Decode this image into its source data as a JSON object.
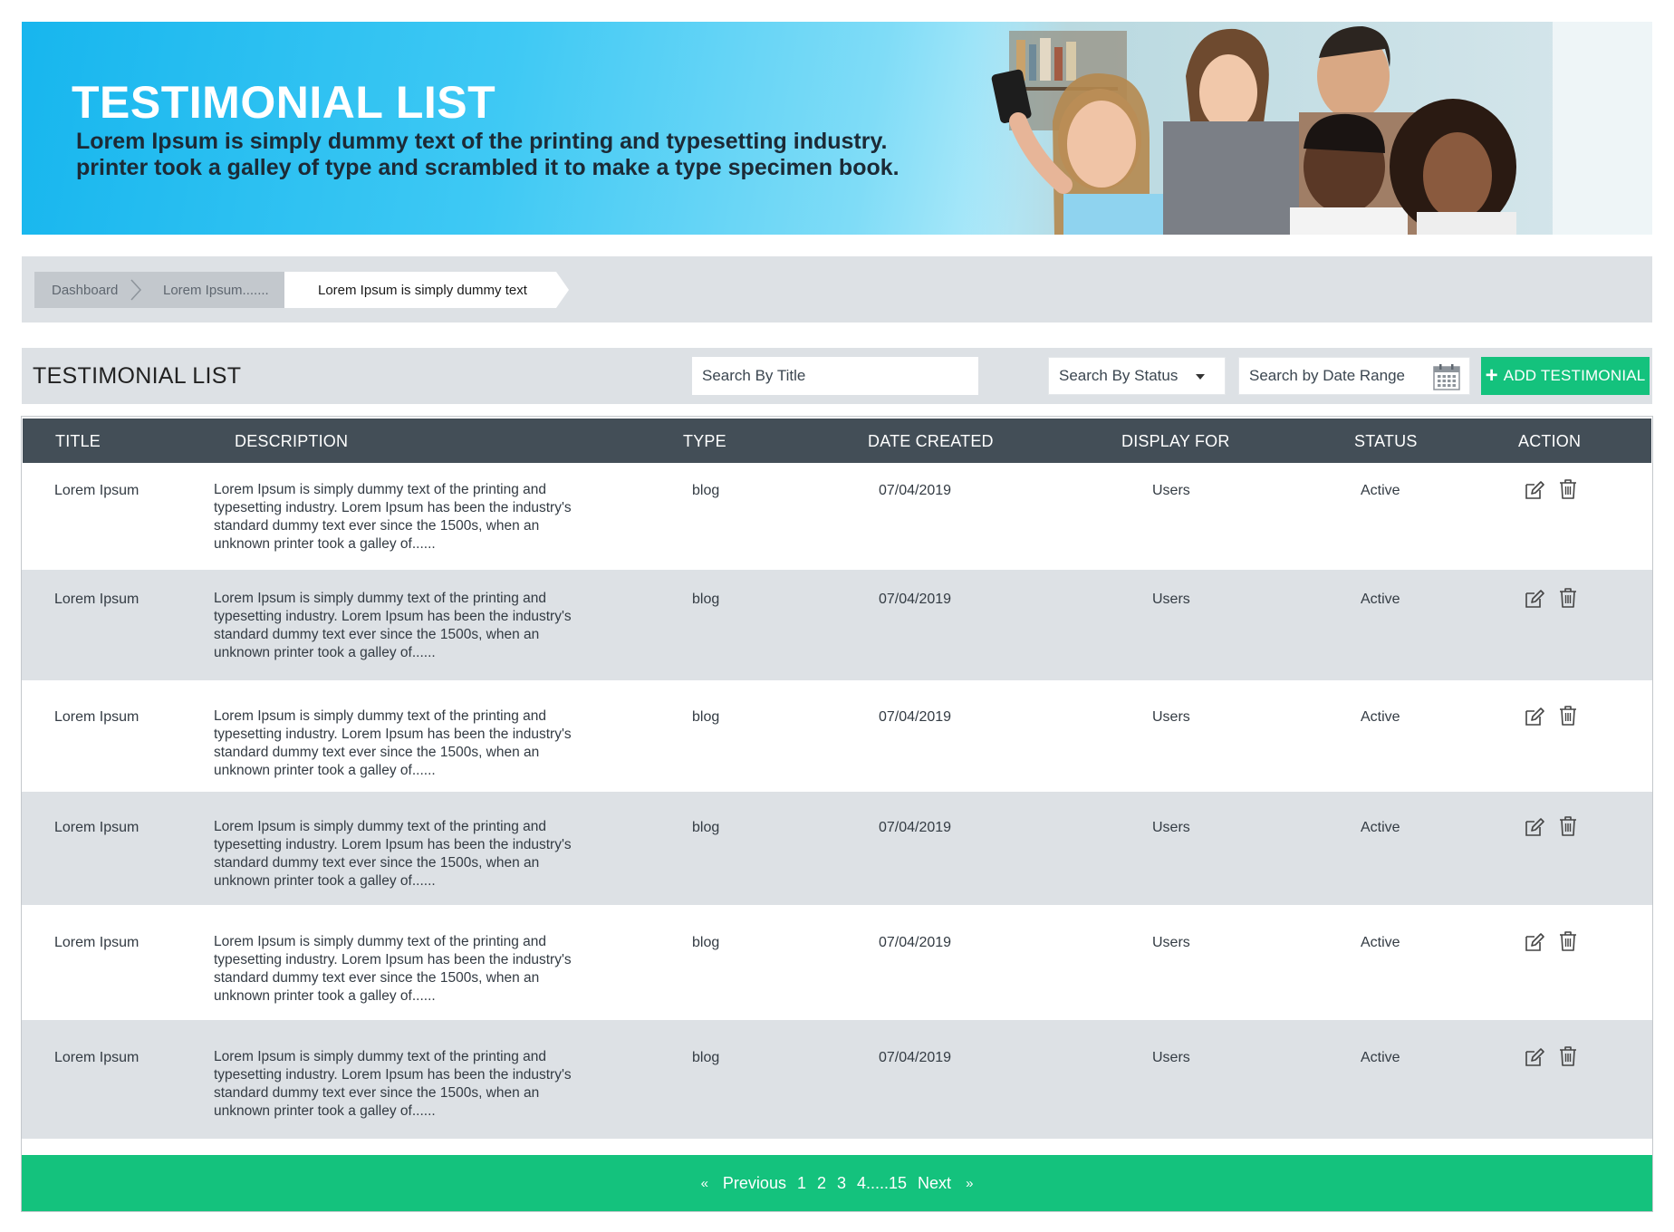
{
  "hero": {
    "title": "TESTIMONIAL LIST",
    "subtitle": "Lorem Ipsum is simply dummy text of the printing and typesetting industry. printer took a galley of type and scrambled it to make a type specimen book."
  },
  "breadcrumb": {
    "items": [
      "Dashboard",
      "Lorem Ipsum.......",
      "Lorem Ipsum is simply dummy text"
    ]
  },
  "toolbar": {
    "title": "TESTIMONIAL LIST",
    "search_title_placeholder": "Search By Title",
    "search_status_label": "Search By Status",
    "search_date_label": "Search by Date Range",
    "add_button_label": "ADD TESTIMONIAL"
  },
  "table": {
    "columns": [
      "TITLE",
      "DESCRIPTION",
      "TYPE",
      "DATE CREATED",
      "DISPLAY FOR",
      "STATUS",
      "ACTION"
    ],
    "rows": [
      {
        "title": "Lorem Ipsum",
        "description": "Lorem Ipsum is simply dummy text of the printing and typesetting industry. Lorem Ipsum has been the industry's standard dummy text ever since the 1500s, when an unknown printer took a galley of......",
        "type": "blog",
        "date": "07/04/2019",
        "display_for": "Users",
        "status": "Active"
      },
      {
        "title": "Lorem Ipsum",
        "description": "Lorem Ipsum is simply dummy text of the printing and typesetting industry. Lorem Ipsum has been the industry's standard dummy text ever since the 1500s, when an unknown printer took a galley of......",
        "type": "blog",
        "date": "07/04/2019",
        "display_for": "Users",
        "status": "Active"
      },
      {
        "title": "Lorem Ipsum",
        "description": "Lorem Ipsum is simply dummy text of the printing and typesetting industry. Lorem Ipsum has been the industry's standard dummy text ever since the 1500s, when an unknown printer took a galley of......",
        "type": "blog",
        "date": "07/04/2019",
        "display_for": "Users",
        "status": "Active"
      },
      {
        "title": "Lorem Ipsum",
        "description": "Lorem Ipsum is simply dummy text of the printing and typesetting industry. Lorem Ipsum has been the industry's standard dummy text ever since the 1500s, when an unknown printer took a galley of......",
        "type": "blog",
        "date": "07/04/2019",
        "display_for": "Users",
        "status": "Active"
      },
      {
        "title": "Lorem Ipsum",
        "description": "Lorem Ipsum is simply dummy text of the printing and typesetting industry. Lorem Ipsum has been the industry's standard dummy text ever since the 1500s, when an unknown printer took a galley of......",
        "type": "blog",
        "date": "07/04/2019",
        "display_for": "Users",
        "status": "Active"
      },
      {
        "title": "Lorem Ipsum",
        "description": "Lorem Ipsum is simply dummy text of the printing and typesetting industry. Lorem Ipsum has been the industry's standard dummy text ever since the 1500s, when an unknown printer took a galley of......",
        "type": "blog",
        "date": "07/04/2019",
        "display_for": "Users",
        "status": "Active"
      }
    ],
    "action_icons": [
      "edit-icon",
      "trash-icon"
    ]
  },
  "pagination": {
    "first": "«",
    "previous": "Previous",
    "pages": [
      "1",
      "2",
      "3",
      "4.....15"
    ],
    "next": "Next",
    "last": "»"
  },
  "colors": {
    "accent_green": "#14c27d",
    "header_dark": "#434e57",
    "banner_blue": "#17b6ee",
    "panel_grey": "#dde1e5"
  }
}
